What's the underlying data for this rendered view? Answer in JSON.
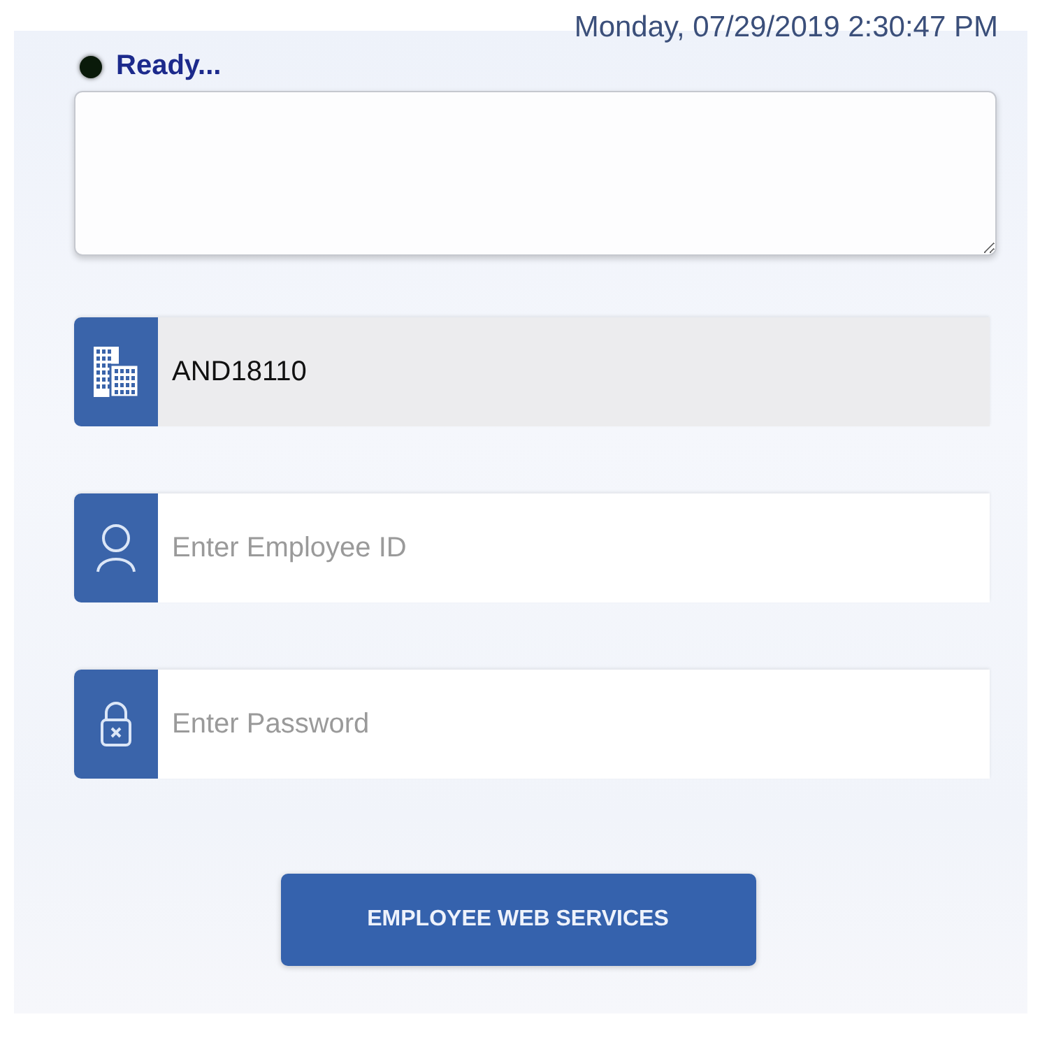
{
  "datetime": "Monday, 07/29/2019 2:30:47 PM",
  "status": {
    "text": "Ready...",
    "color": "#0a1a0a"
  },
  "fields": [
    {
      "kind": "building",
      "value": "AND18110",
      "disabled": true
    },
    {
      "kind": "user",
      "placeholder": "Enter Employee ID",
      "disabled": false
    },
    {
      "kind": "lock",
      "placeholder": "Enter Password",
      "disabled": false
    }
  ],
  "button": "EMPLOYEE WEB SERVICES"
}
